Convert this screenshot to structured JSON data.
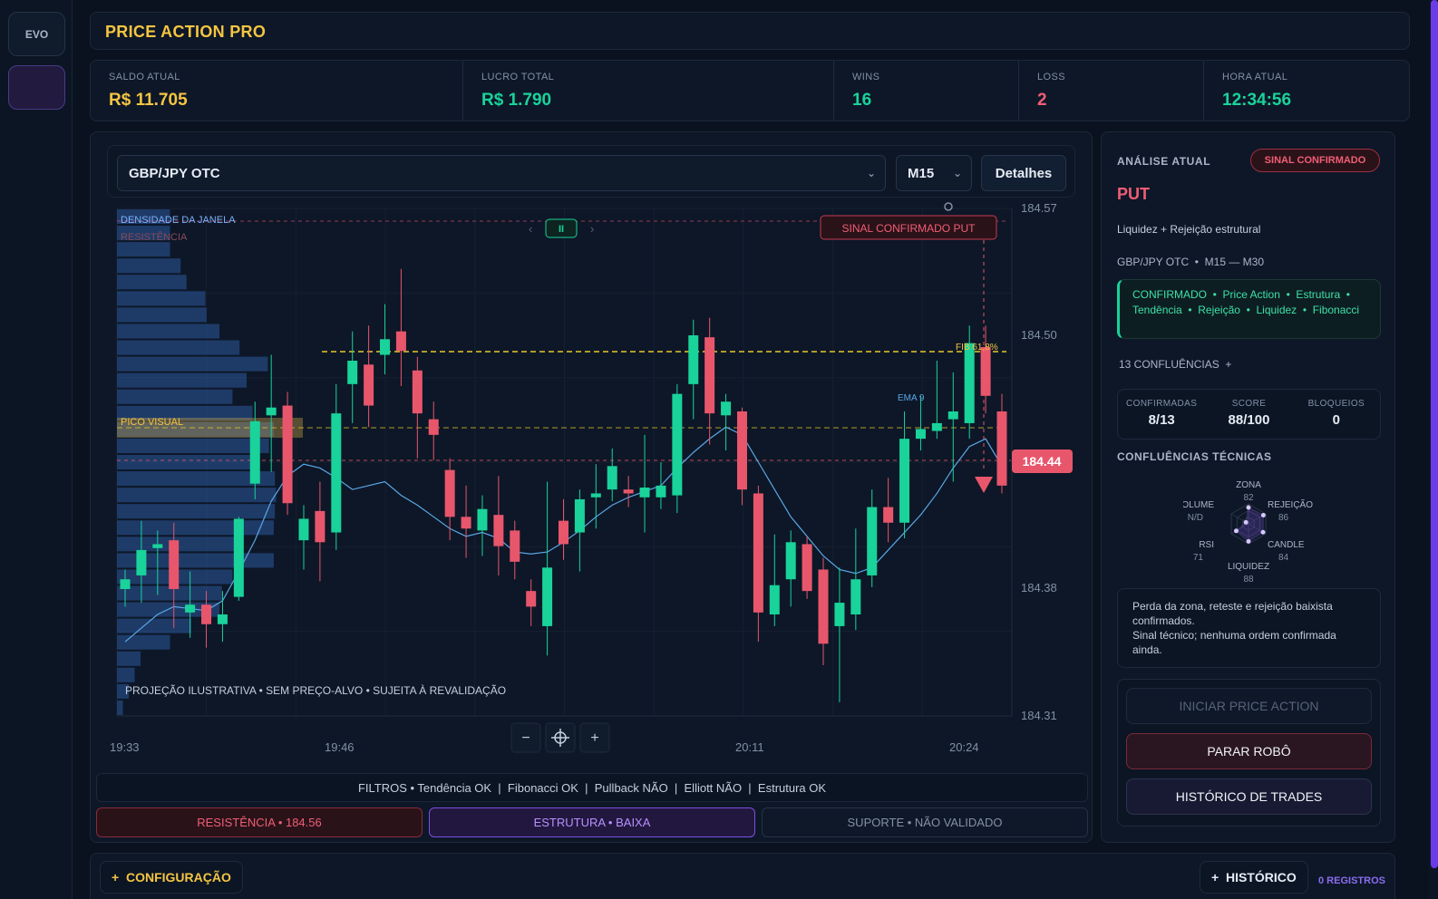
{
  "sidebar": {
    "evo_label": "EVO"
  },
  "header": {
    "title": "PRICE ACTION PRO"
  },
  "stats": [
    {
      "label": "SALDO ATUAL",
      "value": "R$ 11.705",
      "color": "#f5c542"
    },
    {
      "label": "LUCRO TOTAL",
      "value": "R$ 1.790",
      "color": "#19d39a"
    },
    {
      "label": "WINS",
      "value": "16",
      "color": "#19d39a"
    },
    {
      "label": "LOSS",
      "value": "2",
      "color": "#f05e75"
    },
    {
      "label": "HORA ATUAL",
      "value": "12:34:56",
      "color": "#19d39a"
    }
  ],
  "toolbar": {
    "asset": "GBP/JPY OTC",
    "timeframe": "M15",
    "details_label": "Detalhes"
  },
  "chart_data": {
    "type": "candlestick",
    "y_ticks": [
      "184.57",
      "184.50",
      "184.38",
      "184.31"
    ],
    "x_ticks": [
      "19:33",
      "19:46",
      "20:11",
      "20:24"
    ],
    "current_price": "184.44",
    "labels": {
      "density": "DENSIDADE DA JANELA",
      "resistance": "RESISTÊNCIA",
      "peak": "PICO VISUAL",
      "signal": "SINAL CONFIRMADO PUT",
      "fib": "FIB 61,8%",
      "ema": "EMA 9",
      "projection": "PROJEÇÃO ILUSTRATIVA • SEM PREÇO-ALVO • SUJEITA À REVALIDAÇÃO"
    },
    "pager": {
      "prev": "‹",
      "pause": "II",
      "next": "›"
    },
    "zoom": {
      "minus": "−",
      "plus": "+"
    },
    "colors": {
      "up": "#19d39a",
      "down": "#e8566c",
      "ema": "#5aa7e6",
      "fib": "#e9c72a",
      "volume": "#2e5a9e"
    },
    "candles": [
      {
        "o": 184.375,
        "c": 184.38,
        "h": 184.385,
        "l": 184.366
      },
      {
        "o": 184.382,
        "c": 184.395,
        "h": 184.41,
        "l": 184.368
      },
      {
        "o": 184.396,
        "c": 184.398,
        "h": 184.405,
        "l": 184.372
      },
      {
        "o": 184.4,
        "c": 184.375,
        "h": 184.409,
        "l": 184.355
      },
      {
        "o": 184.363,
        "c": 184.367,
        "h": 184.384,
        "l": 184.35
      },
      {
        "o": 184.367,
        "c": 184.357,
        "h": 184.374,
        "l": 184.345
      },
      {
        "o": 184.357,
        "c": 184.362,
        "h": 184.374,
        "l": 184.348
      },
      {
        "o": 184.371,
        "c": 184.411,
        "h": 184.412,
        "l": 184.369
      },
      {
        "o": 184.429,
        "c": 184.461,
        "h": 184.471,
        "l": 184.421
      },
      {
        "o": 184.464,
        "c": 184.468,
        "h": 184.495,
        "l": 184.435
      },
      {
        "o": 184.469,
        "c": 184.419,
        "h": 184.476,
        "l": 184.413
      },
      {
        "o": 184.4,
        "c": 184.411,
        "h": 184.418,
        "l": 184.385
      },
      {
        "o": 184.415,
        "c": 184.399,
        "h": 184.43,
        "l": 184.379
      },
      {
        "o": 184.404,
        "c": 184.465,
        "h": 184.48,
        "l": 184.395
      },
      {
        "o": 184.48,
        "c": 184.492,
        "h": 184.507,
        "l": 184.46
      },
      {
        "o": 184.49,
        "c": 184.469,
        "h": 184.51,
        "l": 184.458
      },
      {
        "o": 184.495,
        "c": 184.503,
        "h": 184.521,
        "l": 184.485
      },
      {
        "o": 184.507,
        "c": 184.497,
        "h": 184.539,
        "l": 184.479
      },
      {
        "o": 184.487,
        "c": 184.465,
        "h": 184.494,
        "l": 184.442
      },
      {
        "o": 184.462,
        "c": 184.454,
        "h": 184.471,
        "l": 184.441
      },
      {
        "o": 184.436,
        "c": 184.412,
        "h": 184.442,
        "l": 184.4
      },
      {
        "o": 184.412,
        "c": 184.406,
        "h": 184.428,
        "l": 184.391
      },
      {
        "o": 184.405,
        "c": 184.416,
        "h": 184.423,
        "l": 184.392
      },
      {
        "o": 184.413,
        "c": 184.397,
        "h": 184.433,
        "l": 184.382
      },
      {
        "o": 184.405,
        "c": 184.389,
        "h": 184.41,
        "l": 184.38
      },
      {
        "o": 184.374,
        "c": 184.366,
        "h": 184.38,
        "l": 184.356
      },
      {
        "o": 184.356,
        "c": 184.386,
        "h": 184.43,
        "l": 184.341
      },
      {
        "o": 184.41,
        "c": 184.398,
        "h": 184.421,
        "l": 184.39
      },
      {
        "o": 184.404,
        "c": 184.421,
        "h": 184.426,
        "l": 184.384
      },
      {
        "o": 184.422,
        "c": 184.424,
        "h": 184.439,
        "l": 184.406
      },
      {
        "o": 184.426,
        "c": 184.438,
        "h": 184.447,
        "l": 184.42
      },
      {
        "o": 184.426,
        "c": 184.424,
        "h": 184.433,
        "l": 184.417
      },
      {
        "o": 184.422,
        "c": 184.427,
        "h": 184.454,
        "l": 184.404
      },
      {
        "o": 184.422,
        "c": 184.428,
        "h": 184.44,
        "l": 184.416
      },
      {
        "o": 184.423,
        "c": 184.475,
        "h": 184.48,
        "l": 184.414
      },
      {
        "o": 184.48,
        "c": 184.505,
        "h": 184.513,
        "l": 184.462
      },
      {
        "o": 184.504,
        "c": 184.465,
        "h": 184.514,
        "l": 184.449
      },
      {
        "o": 184.464,
        "c": 184.471,
        "h": 184.475,
        "l": 184.446
      },
      {
        "o": 184.466,
        "c": 184.426,
        "h": 184.468,
        "l": 184.418
      },
      {
        "o": 184.424,
        "c": 184.363,
        "h": 184.428,
        "l": 184.348
      },
      {
        "o": 184.362,
        "c": 184.377,
        "h": 184.403,
        "l": 184.356
      },
      {
        "o": 184.38,
        "c": 184.399,
        "h": 184.405,
        "l": 184.366
      },
      {
        "o": 184.398,
        "c": 184.374,
        "h": 184.402,
        "l": 184.37
      },
      {
        "o": 184.385,
        "c": 184.347,
        "h": 184.391,
        "l": 184.336
      },
      {
        "o": 184.356,
        "c": 184.368,
        "h": 184.386,
        "l": 184.317
      },
      {
        "o": 184.362,
        "c": 184.38,
        "h": 184.406,
        "l": 184.354
      },
      {
        "o": 184.382,
        "c": 184.417,
        "h": 184.426,
        "l": 184.376
      },
      {
        "o": 184.417,
        "c": 184.409,
        "h": 184.432,
        "l": 184.399
      },
      {
        "o": 184.409,
        "c": 184.452,
        "h": 184.466,
        "l": 184.401
      },
      {
        "o": 184.452,
        "c": 184.457,
        "h": 184.474,
        "l": 184.446
      },
      {
        "o": 184.456,
        "c": 184.46,
        "h": 184.492,
        "l": 184.452
      },
      {
        "o": 184.462,
        "c": 184.466,
        "h": 184.486,
        "l": 184.43
      },
      {
        "o": 184.46,
        "c": 184.501,
        "h": 184.51,
        "l": 184.452
      },
      {
        "o": 184.499,
        "c": 184.474,
        "h": 184.51,
        "l": 184.465
      },
      {
        "o": 184.466,
        "c": 184.428,
        "h": 184.475,
        "l": 184.424
      }
    ],
    "ema9": [
      184.348,
      184.355,
      184.362,
      184.366,
      184.365,
      184.364,
      184.369,
      184.384,
      184.4,
      184.42,
      184.433,
      184.439,
      184.437,
      184.432,
      184.426,
      184.428,
      184.43,
      184.423,
      184.418,
      184.412,
      184.406,
      184.402,
      184.404,
      184.401,
      184.394,
      184.393,
      184.394,
      184.399,
      184.405,
      184.412,
      184.418,
      184.422,
      184.425,
      184.428,
      184.437,
      184.445,
      184.452,
      184.458,
      184.454,
      184.44,
      184.426,
      184.412,
      184.402,
      184.392,
      184.385,
      184.383,
      184.386,
      184.395,
      184.404,
      184.413,
      184.424,
      184.437,
      184.448,
      184.452,
      184.438
    ],
    "volume_profile": [
      0.45,
      0.45,
      0.45,
      0.54,
      0.59,
      0.75,
      0.76,
      0.87,
      1.04,
      1.28,
      1.1,
      0.98,
      1.15,
      1.33,
      1.29,
      1.18,
      1.34,
      1.35,
      1.34,
      1.33,
      1.04,
      1.33,
      0.98,
      0.89,
      0.87,
      0.63,
      0.45,
      0.2,
      0.15,
      0.1,
      0.05
    ]
  },
  "filters": {
    "text": "FILTROS • Tendência OK  |  Fibonacci OK  |  Pullback NÃO  |  Elliott NÃO  |  Estrutura OK"
  },
  "tags": {
    "resistance": "RESISTÊNCIA • 184.56",
    "structure": "ESTRUTURA • BAIXA",
    "support": "SUPORTE • NÃO VALIDADO"
  },
  "analysis": {
    "heading": "ANÁLISE ATUAL",
    "badge": "SINAL CONFIRMADO",
    "direction": "PUT",
    "reason": "Liquidez + Rejeição estrutural",
    "context": "GBP/JPY OTC  •  M15 — M30",
    "confirm_line1": "CONFIRMADO  •  Price Action  •  Estrutura  •",
    "confirm_line2": "Tendência  •  Rejeição  •  Liquidez  •  Fibonacci",
    "confluences_toggle": "13 CONFLUÊNCIAS  +",
    "score": {
      "confirmed_label": "CONFIRMADAS",
      "confirmed_value": "8/13",
      "score_label": "SCORE",
      "score_value": "88/100",
      "blocks_label": "BLOQUEIOS",
      "blocks_value": "0"
    },
    "tech_heading": "CONFLUÊNCIAS TÉCNICAS",
    "radar": [
      {
        "name": "ZONA",
        "value": "82",
        "score": 82
      },
      {
        "name": "REJEIÇÃO",
        "value": "86",
        "score": 86
      },
      {
        "name": "CANDLE",
        "value": "84",
        "score": 84
      },
      {
        "name": "LIQUIDEZ",
        "value": "88",
        "score": 88
      },
      {
        "name": "RSI",
        "value": "71",
        "score": 71
      },
      {
        "name": "VOLUME",
        "value": "N/D",
        "score": 0
      }
    ],
    "note_line1": "Perda da zona, reteste e rejeição baixista",
    "note_line2": "confirmados.",
    "note_line3": "Sinal técnico; nenhuma ordem confirmada",
    "note_line4": "ainda.",
    "btn_start": "INICIAR PRICE ACTION",
    "btn_stop": "PARAR ROBÔ",
    "btn_history": "HISTÓRICO DE TRADES"
  },
  "bottom": {
    "config_label": "+  CONFIGURAÇÃO",
    "history_label": "+  HISTÓRICO",
    "records_label": "0 REGISTROS"
  }
}
